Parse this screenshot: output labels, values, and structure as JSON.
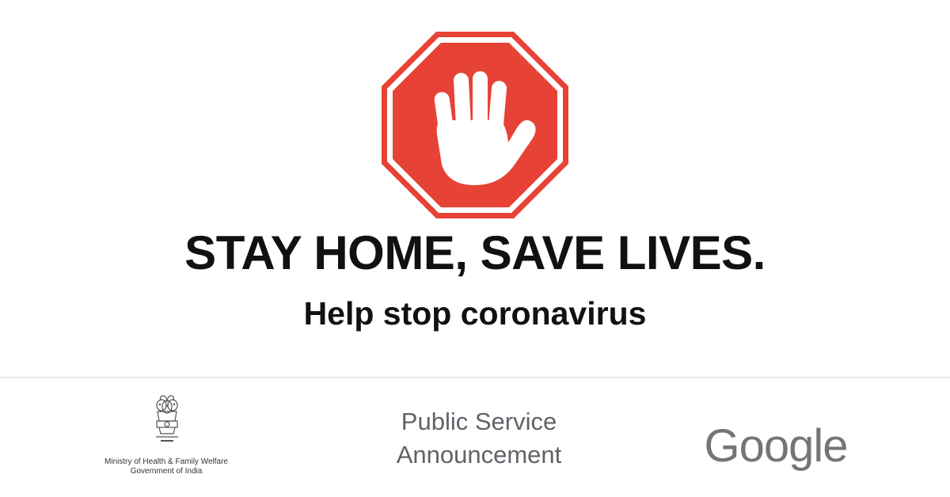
{
  "sign": {
    "icon": "stop-hand-icon",
    "colors": {
      "red": "#e74236",
      "white": "#ffffff"
    }
  },
  "headline": "STAY HOME, SAVE LIVES.",
  "subheadline": "Help stop coronavirus",
  "footer": {
    "emblem_icon": "national-emblem-icon",
    "ministry_line1": "Ministry of Health & Family Welfare",
    "ministry_line2": "Government of India",
    "psa_line1": "Public Service",
    "psa_line2": "Announcement",
    "google_logo": "Google"
  }
}
